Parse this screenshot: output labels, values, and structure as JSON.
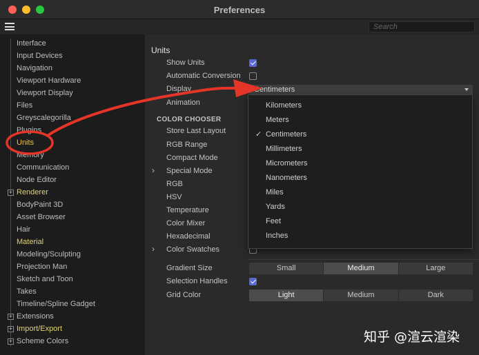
{
  "window": {
    "title": "Preferences",
    "colors": {
      "accent": "#5a6ad2",
      "highlight_yellow": "#e2d46e",
      "annotation_red": "#e53528"
    }
  },
  "toolbar": {
    "menu_icon": "hamburger-icon",
    "search_placeholder": "Search"
  },
  "sidebar": {
    "items": [
      {
        "label": "Interface"
      },
      {
        "label": "Input Devices"
      },
      {
        "label": "Navigation"
      },
      {
        "label": "Viewport Hardware"
      },
      {
        "label": "Viewport Display"
      },
      {
        "label": "Files"
      },
      {
        "label": "Greyscalegorilla"
      },
      {
        "label": "Plugins"
      },
      {
        "label": "Units",
        "selected": true
      },
      {
        "label": "Memory"
      },
      {
        "label": "Communication"
      },
      {
        "label": "Node Editor"
      },
      {
        "label": "Renderer",
        "expandable": true
      },
      {
        "label": "BodyPaint 3D"
      },
      {
        "label": "Asset Browser"
      },
      {
        "label": "Hair"
      },
      {
        "label": "Material"
      },
      {
        "label": "Modeling/Sculpting"
      },
      {
        "label": "Projection Man"
      },
      {
        "label": "Sketch and Toon"
      },
      {
        "label": "Takes"
      },
      {
        "label": "Timeline/Spline Gadget"
      },
      {
        "label": "Extensions",
        "expandable": true
      },
      {
        "label": "Import/Export",
        "expandable": true
      },
      {
        "label": "Scheme Colors",
        "expandable": true
      }
    ]
  },
  "main": {
    "section_title": "Units",
    "rows": {
      "show_units": {
        "label": "Show Units",
        "checked": true
      },
      "automatic_conversion": {
        "label": "Automatic Conversion",
        "checked": false
      },
      "display": {
        "label": "Display",
        "value": "Centimeters"
      },
      "animation": {
        "label": "Animation"
      }
    },
    "color_chooser": {
      "group_label": "COLOR CHOOSER",
      "items": [
        "Store Last Layout",
        "RGB Range",
        "Compact Mode",
        "Special Mode",
        "RGB",
        "HSV",
        "Temperature",
        "Color Mixer",
        "Hexadecimal",
        "Color Swatches"
      ]
    },
    "display_options": [
      "Kilometers",
      "Meters",
      "Centimeters",
      "Millimeters",
      "Micrometers",
      "Nanometers",
      "Miles",
      "Yards",
      "Feet",
      "Inches"
    ],
    "display_selected": "Centimeters",
    "gradient_size": {
      "label": "Gradient Size",
      "options": [
        "Small",
        "Medium",
        "Large"
      ],
      "selected": "Medium"
    },
    "selection_handles": {
      "label": "Selection Handles",
      "checked": true
    },
    "grid_color": {
      "label": "Grid Color",
      "options": [
        "Light",
        "Medium",
        "Dark"
      ],
      "selected": "Light"
    }
  },
  "watermark": "知乎 @渲云渲染"
}
